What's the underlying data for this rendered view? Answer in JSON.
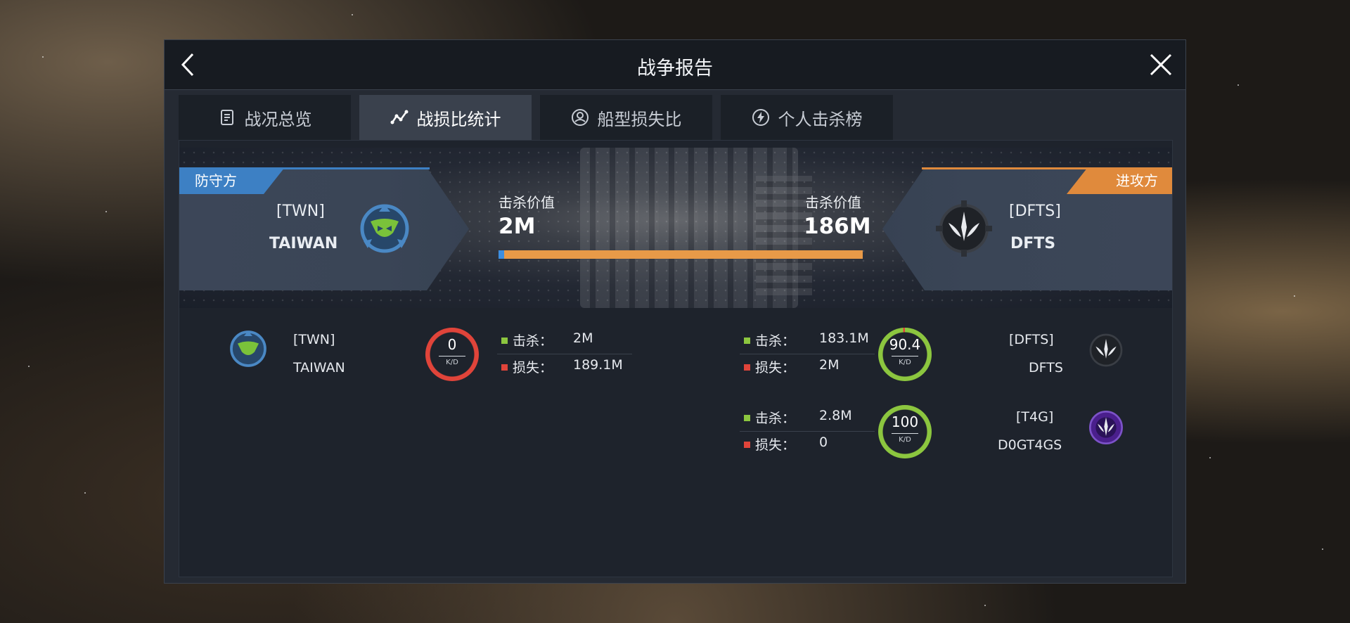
{
  "window": {
    "title": "战争报告"
  },
  "tabs": [
    {
      "label": "战况总览",
      "icon": "document-icon",
      "active": false
    },
    {
      "label": "战损比统计",
      "icon": "line-chart-icon",
      "active": true
    },
    {
      "label": "船型损失比",
      "icon": "ship-type-icon",
      "active": false
    },
    {
      "label": "个人击杀榜",
      "icon": "lightning-icon",
      "active": false
    }
  ],
  "banner": {
    "defender": {
      "role": "防守方",
      "tag": "[TWN]",
      "name": "TAIWAN",
      "color": "#3d80c4"
    },
    "attacker": {
      "role": "进攻方",
      "tag": "[DFTS]",
      "name": "DFTS",
      "color": "#e08a3c"
    },
    "kill_value_label_left": "击杀价值",
    "kill_value_left": "2M",
    "kill_value_label_right": "击杀价值",
    "kill_value_right": "186M",
    "defender_share": 0.0106
  },
  "labels": {
    "kills": "击杀：",
    "losses": "损失：",
    "kd": "K/D"
  },
  "defenders": [
    {
      "tag": "[TWN]",
      "name": "TAIWAN",
      "kills": "2M",
      "losses": "189.1M",
      "kd": "0",
      "kd_ratio": 0.0,
      "ring_color": "#e0443a"
    }
  ],
  "attackers": [
    {
      "tag": "[DFTS]",
      "name": "DFTS",
      "kills": "183.1M",
      "losses": "2M",
      "kd": "90.4",
      "kd_ratio": 0.989,
      "ring_color": "#8cc63f"
    },
    {
      "tag": "[T4G]",
      "name": "D0GT4GS",
      "kills": "2.8M",
      "losses": "0",
      "kd": "100",
      "kd_ratio": 1.0,
      "ring_color": "#8cc63f"
    }
  ]
}
